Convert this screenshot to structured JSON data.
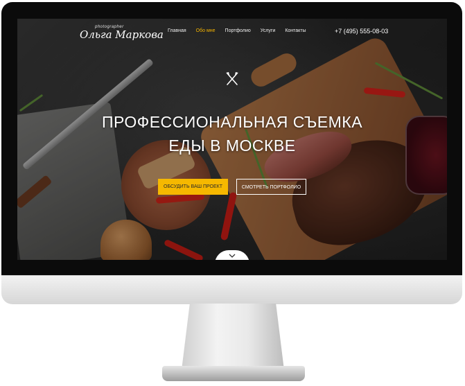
{
  "site": {
    "logo": {
      "sub": "photographer",
      "name": "Ольга Маркова"
    },
    "nav": [
      {
        "label": "Главная",
        "active": false
      },
      {
        "label": "Обо мне",
        "active": true
      },
      {
        "label": "Портфолио",
        "active": false
      },
      {
        "label": "Услуги",
        "active": false
      },
      {
        "label": "Контакты",
        "active": false
      }
    ],
    "phone": "+7 (495) 555-08-03",
    "hero": {
      "icon": "fork-knife-icon",
      "title_line1": "ПРОФЕССИОНАЛЬНАЯ СЪЕМКА",
      "title_line2": "ЕДЫ В МОСКВЕ",
      "primary_button": "Обсудить ваш проект",
      "secondary_button": "Смотреть портфолио"
    },
    "scroll_icon": "chevron-down-icon"
  },
  "colors": {
    "accent": "#f6b800",
    "active_nav": "#f5b400",
    "text": "#ffffff"
  }
}
